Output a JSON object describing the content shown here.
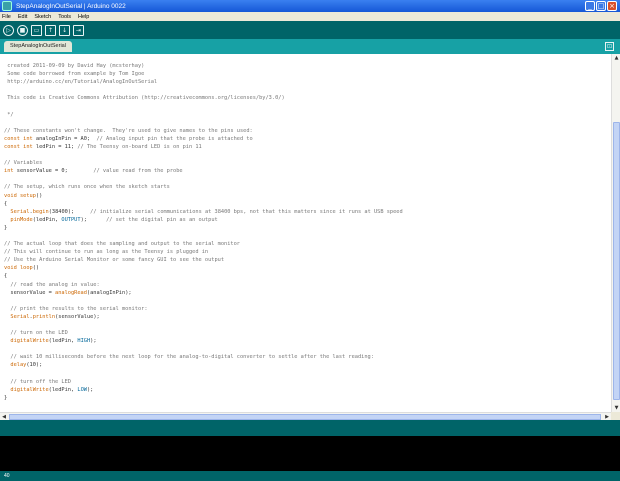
{
  "window": {
    "title": "StepAnalogInOutSerial | Arduino 0022",
    "minimize_glyph": "_",
    "maximize_glyph": "□",
    "close_glyph": "×"
  },
  "menu": [
    "File",
    "Edit",
    "Sketch",
    "Tools",
    "Help"
  ],
  "toolbar": {
    "buttons": [
      {
        "name": "verify",
        "glyph": "▷"
      },
      {
        "name": "stop",
        "glyph": "■"
      },
      {
        "name": "new",
        "glyph": "▭"
      },
      {
        "name": "open",
        "glyph": "↑"
      },
      {
        "name": "save",
        "glyph": "↓"
      },
      {
        "name": "upload",
        "glyph": "⇥"
      }
    ],
    "serial_monitor_glyph": "⊡"
  },
  "tab": {
    "label": "StepAnalogInOutSerial"
  },
  "code": [
    [
      {
        "t": " created 2011-09-09 by David Hay (mcsterhay)",
        "c": "c"
      }
    ],
    [
      {
        "t": " Some code borrowed from example by Tom Igoe",
        "c": "c"
      }
    ],
    [
      {
        "t": " http://arduino.cc/en/Tutorial/AnalogInOutSerial",
        "c": "c"
      }
    ],
    [],
    [
      {
        "t": " This code is Creative Commons Attribution (http://creativecommons.org/licenses/by/3.0/)",
        "c": "c"
      }
    ],
    [],
    [
      {
        "t": " */",
        "c": "c"
      }
    ],
    [],
    [
      {
        "t": "// These constants won't change.  They're used to give names to the pins used:",
        "c": "c"
      }
    ],
    [
      {
        "t": "const int",
        "c": "k"
      },
      {
        "t": " analogInPin = A0;  ",
        "c": ""
      },
      {
        "t": "// Analog input pin that the probe is attached to",
        "c": "c"
      }
    ],
    [
      {
        "t": "const int",
        "c": "k"
      },
      {
        "t": " ledPin = 11; ",
        "c": ""
      },
      {
        "t": "// The Teensy on-board LED is on pin 11",
        "c": "c"
      }
    ],
    [],
    [
      {
        "t": "// Variables",
        "c": "c"
      }
    ],
    [
      {
        "t": "int",
        "c": "k"
      },
      {
        "t": " sensorValue = 0;        ",
        "c": ""
      },
      {
        "t": "// value read from the probe",
        "c": "c"
      }
    ],
    [],
    [
      {
        "t": "// The setup, which runs once when the sketch starts",
        "c": "c"
      }
    ],
    [
      {
        "t": "void",
        "c": "k"
      },
      {
        "t": " ",
        "c": ""
      },
      {
        "t": "setup",
        "c": "f"
      },
      {
        "t": "()",
        "c": ""
      }
    ],
    [
      {
        "t": "{",
        "c": ""
      }
    ],
    [
      {
        "t": "  ",
        "c": ""
      },
      {
        "t": "Serial",
        "c": "f"
      },
      {
        "t": ".",
        "c": ""
      },
      {
        "t": "begin",
        "c": "f"
      },
      {
        "t": "(38400);     ",
        "c": ""
      },
      {
        "t": "// initialize serial communications at 38400 bps, not that this matters since it runs at USB speed",
        "c": "c"
      }
    ],
    [
      {
        "t": "  ",
        "c": ""
      },
      {
        "t": "pinMode",
        "c": "f"
      },
      {
        "t": "(ledPin, ",
        "c": ""
      },
      {
        "t": "OUTPUT",
        "c": "n"
      },
      {
        "t": ");      ",
        "c": ""
      },
      {
        "t": "// set the digital pin as an output",
        "c": "c"
      }
    ],
    [
      {
        "t": "}",
        "c": ""
      }
    ],
    [],
    [
      {
        "t": "// The actual loop that does the sampling and output to the serial monitor",
        "c": "c"
      }
    ],
    [
      {
        "t": "// This will continue to run as long as the Teensy is plugged in",
        "c": "c"
      }
    ],
    [
      {
        "t": "// Use the Arduino Serial Monitor or some fancy GUI to see the output",
        "c": "c"
      }
    ],
    [
      {
        "t": "void",
        "c": "k"
      },
      {
        "t": " ",
        "c": ""
      },
      {
        "t": "loop",
        "c": "f"
      },
      {
        "t": "()",
        "c": ""
      }
    ],
    [
      {
        "t": "{",
        "c": ""
      }
    ],
    [
      {
        "t": "  // read the analog in value:",
        "c": "c"
      }
    ],
    [
      {
        "t": "  sensorValue = ",
        "c": ""
      },
      {
        "t": "analogRead",
        "c": "f"
      },
      {
        "t": "(analogInPin);",
        "c": ""
      }
    ],
    [],
    [
      {
        "t": "  // print the results to the serial monitor:",
        "c": "c"
      }
    ],
    [
      {
        "t": "  ",
        "c": ""
      },
      {
        "t": "Serial",
        "c": "f"
      },
      {
        "t": ".",
        "c": ""
      },
      {
        "t": "println",
        "c": "f"
      },
      {
        "t": "(sensorValue);",
        "c": ""
      }
    ],
    [],
    [
      {
        "t": "  // turn on the LED",
        "c": "c"
      }
    ],
    [
      {
        "t": "  ",
        "c": ""
      },
      {
        "t": "digitalWrite",
        "c": "f"
      },
      {
        "t": "(ledPin, ",
        "c": ""
      },
      {
        "t": "HIGH",
        "c": "n"
      },
      {
        "t": ");",
        "c": ""
      }
    ],
    [],
    [
      {
        "t": "  // wait 10 milliseconds before the next loop for the analog-to-digital converter to settle after the last reading:",
        "c": "c"
      }
    ],
    [
      {
        "t": "  ",
        "c": ""
      },
      {
        "t": "delay",
        "c": "f"
      },
      {
        "t": "(10);",
        "c": ""
      }
    ],
    [],
    [
      {
        "t": "  // turn off the LED",
        "c": "c"
      }
    ],
    [
      {
        "t": "  ",
        "c": ""
      },
      {
        "t": "digitalWrite",
        "c": "f"
      },
      {
        "t": "(ledPin, ",
        "c": ""
      },
      {
        "t": "LOW",
        "c": "n"
      },
      {
        "t": ");",
        "c": ""
      }
    ],
    [
      {
        "t": "}",
        "c": ""
      }
    ]
  ],
  "footer": {
    "line_number": "40"
  },
  "colors": {
    "toolbar_bg": "#006468",
    "tab_bg": "#17a1a5",
    "comment": "#777777",
    "keyword": "#cc6600",
    "constant": "#006699"
  }
}
